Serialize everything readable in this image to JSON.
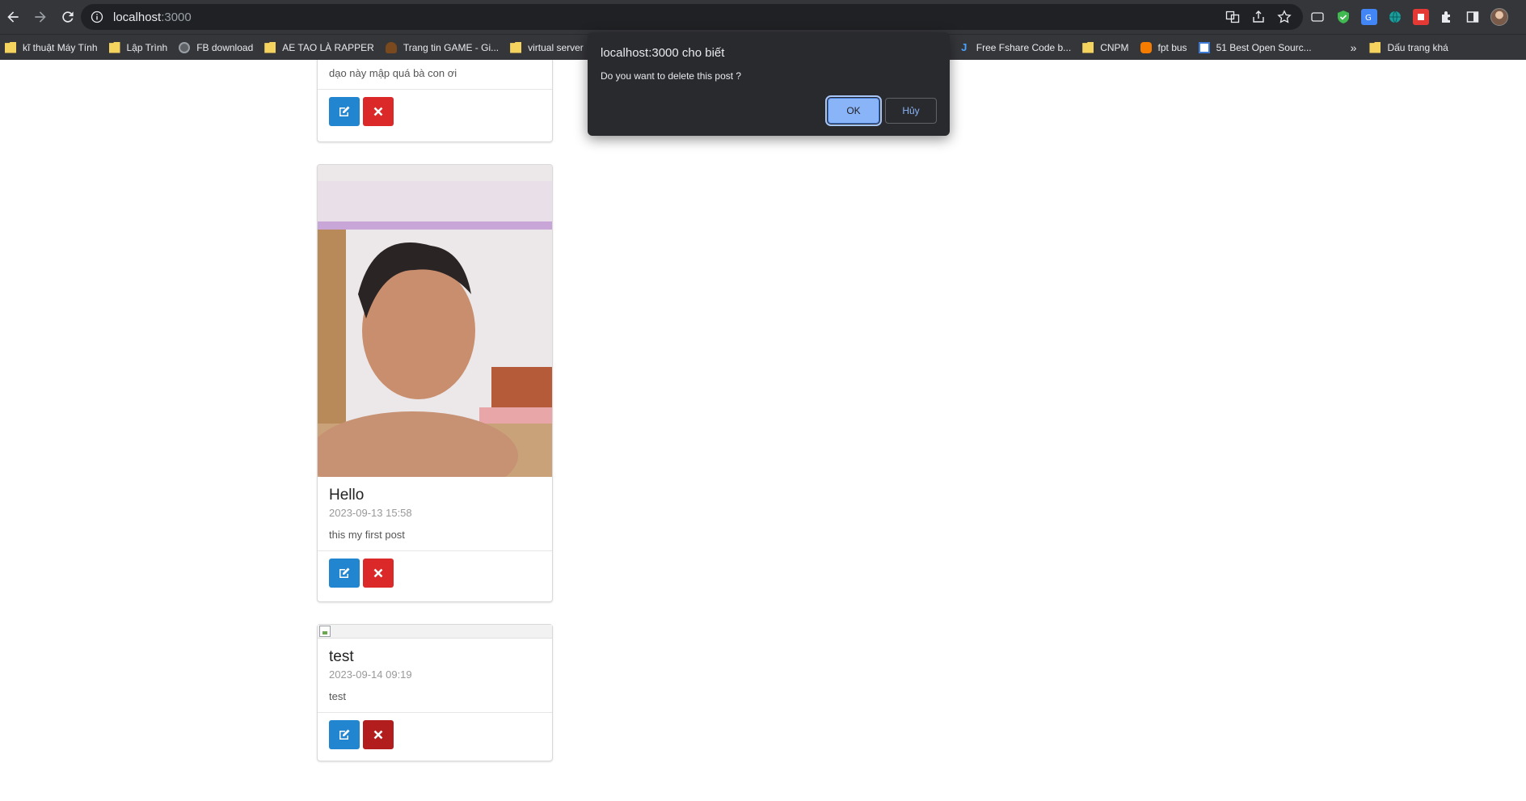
{
  "browser": {
    "url_host": "localhost",
    "url_port": ":3000",
    "bookmarks": [
      {
        "label": "kĩ thuật Máy Tính",
        "icon": "folder-icon"
      },
      {
        "label": "Lập Trình",
        "icon": "folder-icon"
      },
      {
        "label": "FB download",
        "icon": "globe-icon"
      },
      {
        "label": "AE TAO LÀ RAPPER",
        "icon": "folder-icon"
      },
      {
        "label": "Trang tin GAME - Gi...",
        "icon": "game-site-icon"
      },
      {
        "label": "virtual server",
        "icon": "folder-icon"
      },
      {
        "label": "Free Fshare Code b...",
        "icon": "j-site-icon"
      },
      {
        "label": "CNPM",
        "icon": "folder-icon"
      },
      {
        "label": "fpt bus",
        "icon": "bus-icon"
      },
      {
        "label": "51 Best Open Sourc...",
        "icon": "site-icon"
      }
    ],
    "overflow_label": "»",
    "other_bookmarks": "Dấu trang khá"
  },
  "posts": [
    {
      "title": "",
      "date": "",
      "content": "dạo này mập quá bà con ơi"
    },
    {
      "title": "Hello",
      "date": "2023-09-13 15:58",
      "content": "this my first post"
    },
    {
      "title": "test",
      "date": "2023-09-14 09:19",
      "content": "test"
    }
  ],
  "dialog": {
    "title": "localhost:3000 cho biết",
    "message": "Do you want to delete this post ?",
    "ok_label": "OK",
    "cancel_label": "Hủy"
  },
  "colors": {
    "edit_button": "#2185d0",
    "delete_button": "#db2828",
    "dialog_bg": "#292a2d",
    "ok_button": "#8ab4f8"
  }
}
